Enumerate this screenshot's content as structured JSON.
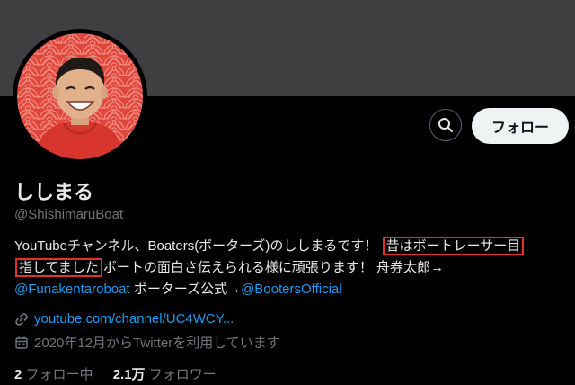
{
  "profile": {
    "display_name": "ししまる",
    "handle": "@ShishimaruBoat",
    "bio": {
      "line1_a": "YouTubeチャンネル、Boaters(ボーターズ)のししまるです！ ",
      "line1_highlight": "昔はボートレーサー目",
      "line2_highlight": "指してました",
      "line2_b": "ボートの面白さ伝えられる様に頑張ります！ 舟券太郎→",
      "mention1": "@Funakentaroboat",
      "line3_mid": " ボーターズ公式→",
      "mention2": "@BootersOfficial"
    },
    "website": "youtube.com/channel/UC4WCY...",
    "joined": "2020年12月からTwitterを利用しています"
  },
  "actions": {
    "follow_label": "フォロー",
    "search_icon": "search-icon"
  },
  "stats": {
    "following_count": "2",
    "following_label": "フォロー中",
    "followers_count": "2.1万",
    "followers_label": "フォロワー"
  },
  "colors": {
    "accent": "#1d9bf0",
    "highlight_box": "#e0322b",
    "banner": "#3f3f42",
    "avatar_bg": "#e0463c"
  }
}
